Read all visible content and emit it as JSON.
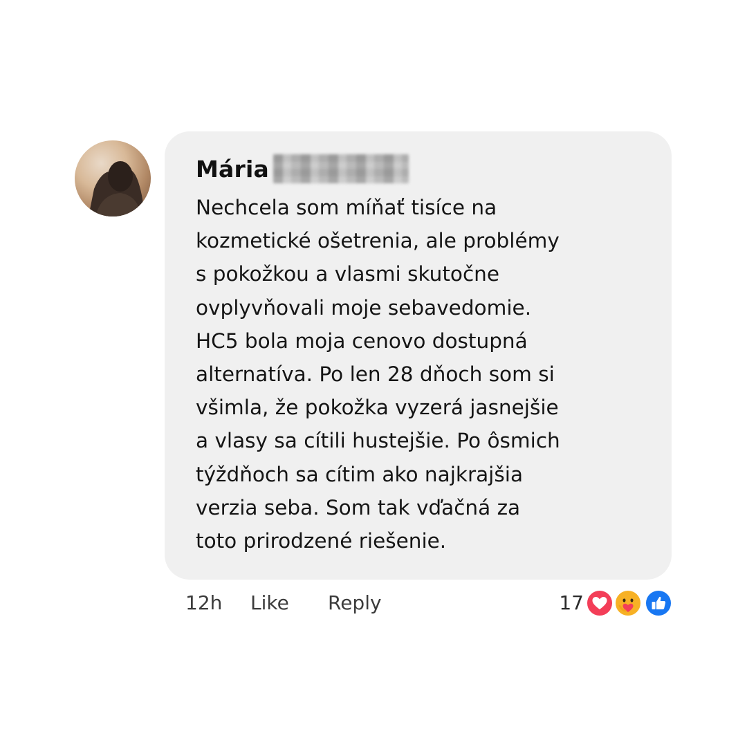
{
  "comment": {
    "author_name": "Mária",
    "author_surname_blurred": true,
    "text": "Nechcela som míňať tisíce na\nkozmetické ošetrenia, ale problémy\ns pokožkou a vlasmi skutočne\novplyvňovali moje sebavedomie.\nHC5 bola moja cenovo dostupná\nalternatíva. Po len 28 dňoch som si\nvšimla, že pokožka vyzerá jasnejšie\na vlasy sa cítili hustejšie. Po ôsmich\ntýždňoch sa cítim ako najkrajšia\nverzia seba. Som tak vďačná za\ntoto prirodzené riešenie.",
    "bubble_color": "#f0f0f0"
  },
  "meta": {
    "time": "12h",
    "like_label": "Like",
    "reply_label": "Reply"
  },
  "reactions": {
    "count": "17",
    "icons": [
      "heart-icon",
      "care-icon",
      "thumbs-up-icon"
    ],
    "colors": {
      "love": "#f33e58",
      "care": "#f7b125",
      "like": "#1877f2"
    }
  }
}
